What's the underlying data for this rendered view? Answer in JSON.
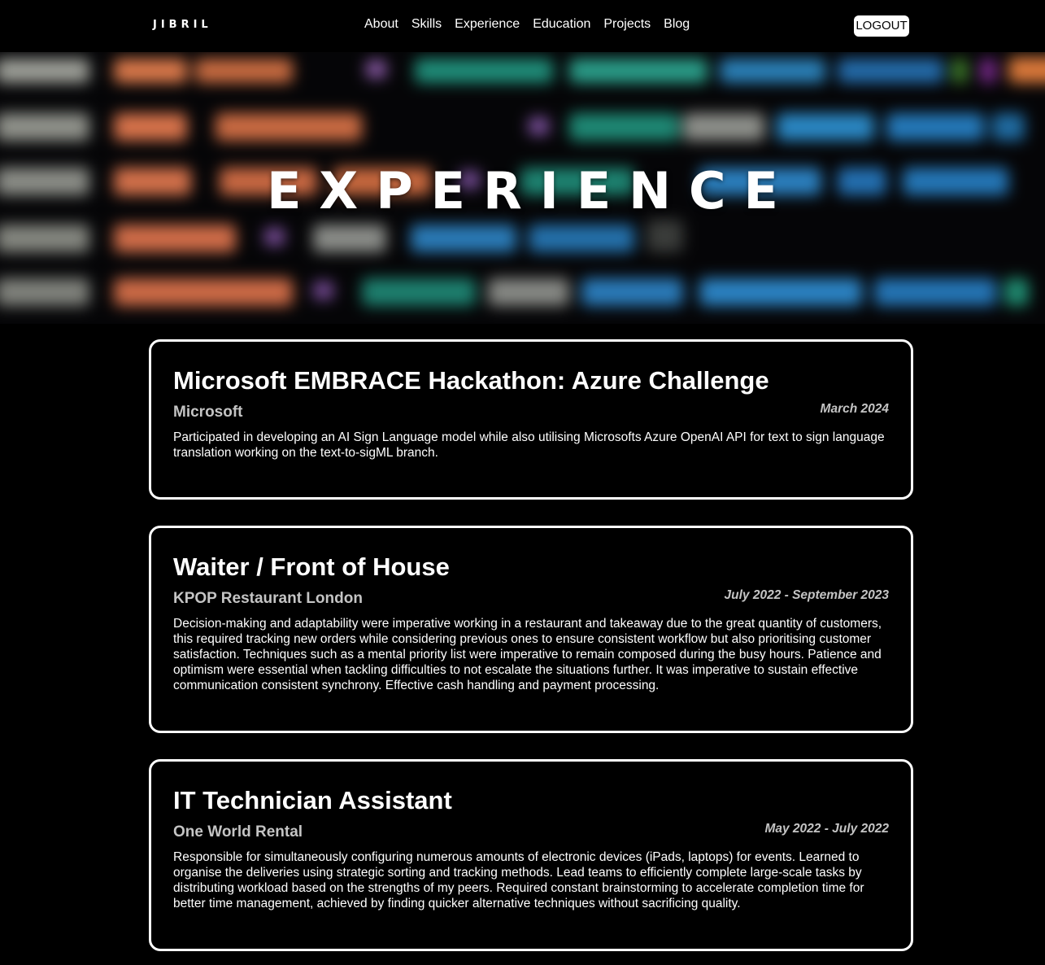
{
  "nav": {
    "brand": "JIBRIL",
    "links": [
      "About",
      "Skills",
      "Experience",
      "Education",
      "Projects",
      "Blog"
    ],
    "logout_label": "LOGOUT"
  },
  "hero": {
    "title": "EXPERIENCE"
  },
  "experiences": [
    {
      "title": "Microsoft EMBRACE Hackathon: Azure Challenge",
      "company": "Microsoft",
      "date": "March 2024",
      "description": "Participated in developing an AI Sign Language model while also utilising Microsofts Azure OpenAI API for text to sign language translation working on the text-to-sigML branch."
    },
    {
      "title": "Waiter / Front of House",
      "company": "KPOP Restaurant London",
      "date": "July 2022 - September 2023",
      "description": "Decision-making and adaptability were imperative working in a restaurant and takeaway due to the great quantity of customers, this required tracking new orders while considering previous ones to ensure consistent workflow but also prioritising customer satisfaction. Techniques such as a mental priority list were imperative to remain composed during the busy hours. Patience and optimism were essential when tackling difficulties to not escalate the situations further. It was imperative to sustain effective communication consistent synchrony. Effective cash handling and payment processing."
    },
    {
      "title": "IT Technician Assistant",
      "company": "One World Rental",
      "date": "May 2022 - July 2022",
      "description": "Responsible for simultaneously configuring numerous amounts of electronic devices (iPads, laptops) for events. Learned to organise the deliveries using strategic sorting and tracking methods. Lead teams to efficiently complete large-scale tasks by distributing workload based on the strengths of my peers. Required constant brainstorming to accelerate completion time for better time management, achieved by finding quicker alternative techniques without sacrificing quality."
    }
  ]
}
